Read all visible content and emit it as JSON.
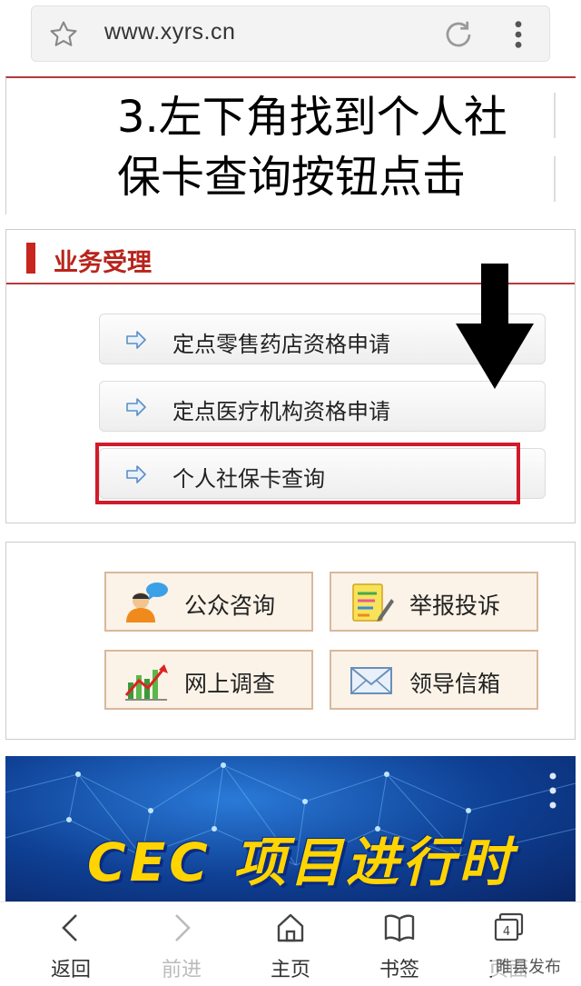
{
  "browser": {
    "url": "www.xyrs.cn"
  },
  "instruction": {
    "line1": "3.左下角找到个人社",
    "line2": "保卡查询按钮点击"
  },
  "business": {
    "title": "业务受理",
    "items": [
      {
        "label": "定点零售药店资格申请"
      },
      {
        "label": "定点医疗机构资格申请"
      },
      {
        "label": "个人社保卡查询"
      }
    ]
  },
  "tiles": [
    {
      "label": "公众咨询",
      "icon": "consult-icon"
    },
    {
      "label": "举报投诉",
      "icon": "report-icon"
    },
    {
      "label": "网上调查",
      "icon": "survey-chart-icon"
    },
    {
      "label": "领导信箱",
      "icon": "mail-icon"
    }
  ],
  "promo": {
    "text": "CEC 项目进行时"
  },
  "bottom_nav": {
    "back": "返回",
    "forward": "前进",
    "home": "主页",
    "bookmarks": "书签",
    "tabs": "页面",
    "tab_count": "4"
  },
  "watermark": "睢县发布",
  "colors": {
    "accent_red": "#c8251f",
    "highlight_red": "#d11a2a",
    "promo_yellow": "#ffd400",
    "promo_blue": "#0e3f93"
  }
}
